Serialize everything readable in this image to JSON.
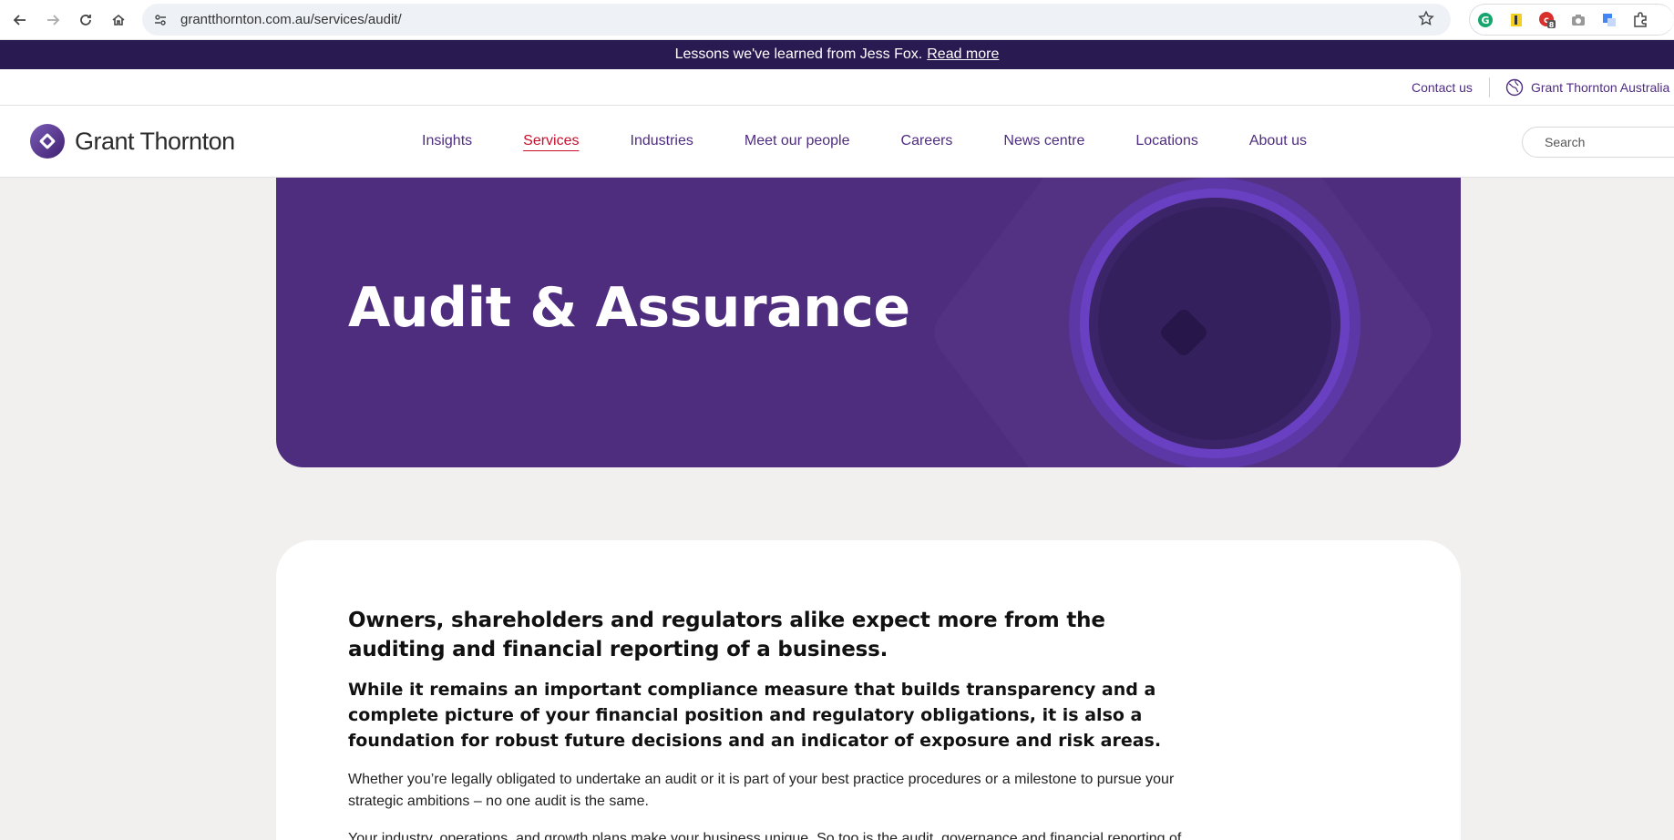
{
  "browser": {
    "url": "grantthornton.com.au/services/audit/",
    "extension_badge": "8"
  },
  "announcement": {
    "text": "Lessons we've learned from Jess Fox.",
    "link": "Read more"
  },
  "utility": {
    "contact": "Contact us",
    "region": "Grant Thornton Australia"
  },
  "header": {
    "logo": "Grant Thornton",
    "nav": [
      "Insights",
      "Services",
      "Industries",
      "Meet our people",
      "Careers",
      "News centre",
      "Locations",
      "About us"
    ],
    "active": "Services",
    "search_placeholder": "Search"
  },
  "hero": {
    "title": "Audit & Assurance"
  },
  "content": {
    "lead1": "Owners, shareholders and regulators alike expect more from the auditing and financial reporting of a business.",
    "lead2": "While it remains an important compliance measure that builds transparency and a complete picture of your financial position and regulatory obligations, it is also a foundation for robust future decisions and an indicator of exposure and risk areas.",
    "para1": "Whether you’re legally obligated to undertake an audit or it is part of your best practice procedures or a milestone to pursue your strategic ambitions – no one audit is the same.",
    "para2": "Your industry, operations, and growth plans make your business unique. So too is the audit, governance and financial reporting of"
  },
  "colors": {
    "brand_purple": "#4f2d7f",
    "announcement_bg": "#2a1a52",
    "active_red": "#c8102e",
    "page_bg": "#f1f0ee"
  }
}
